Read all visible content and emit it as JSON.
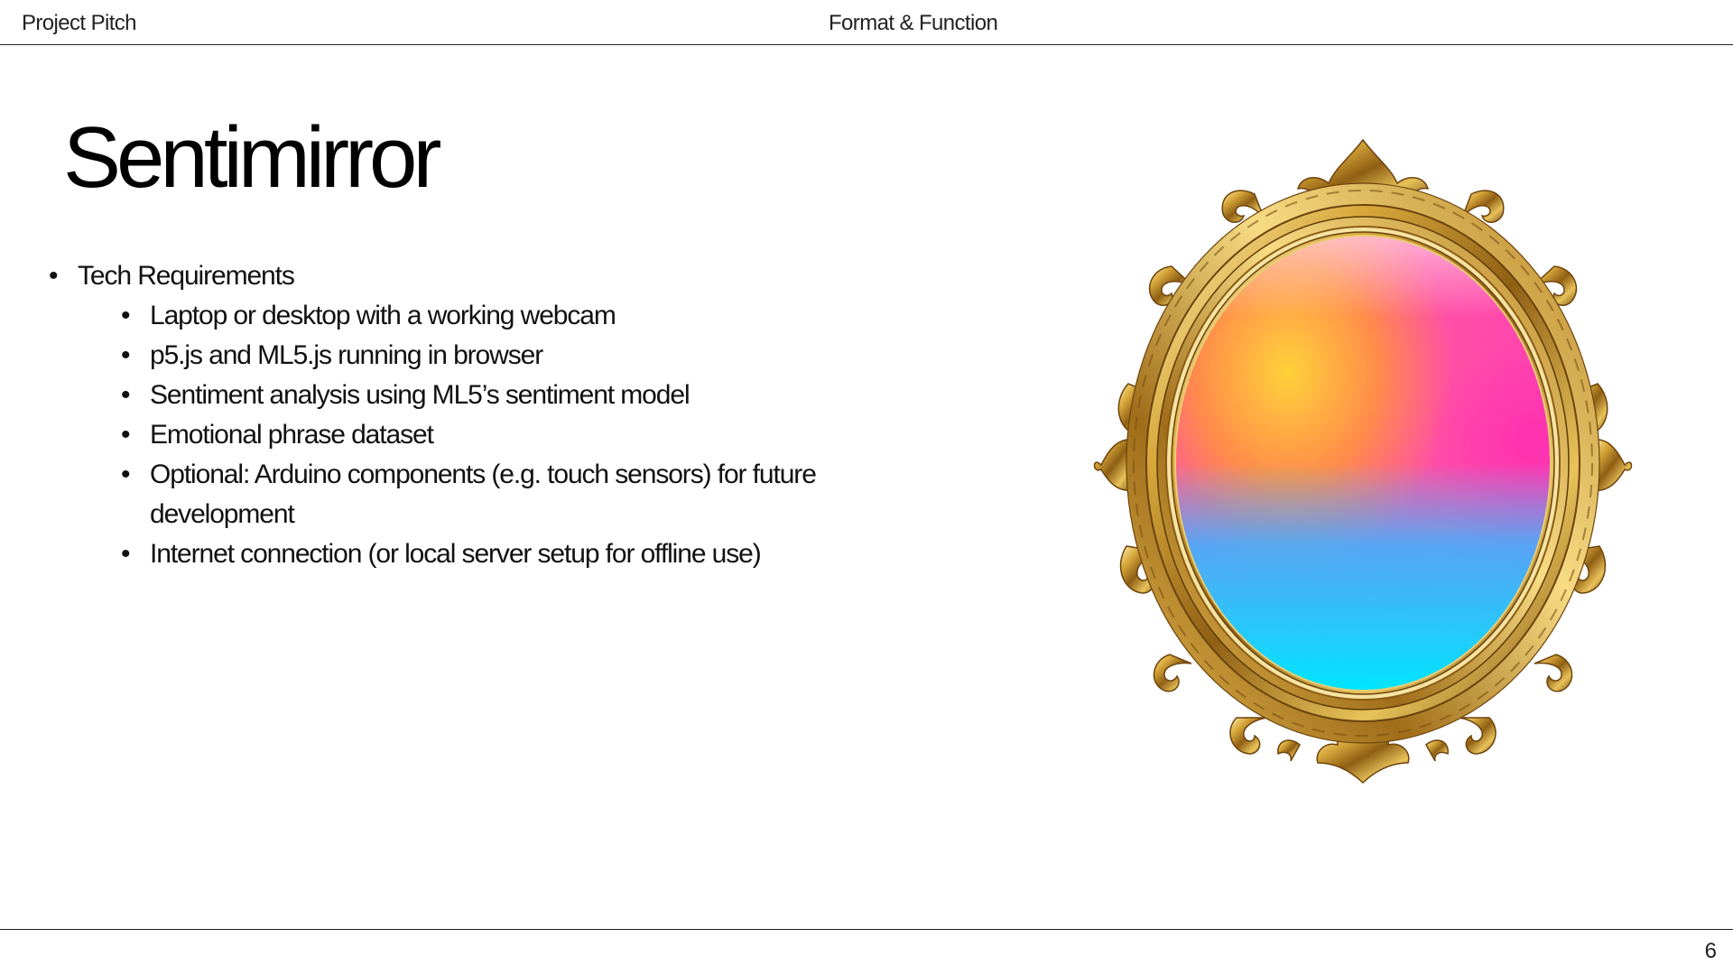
{
  "header": {
    "left": "Project Pitch",
    "center": "Format & Function"
  },
  "slide": {
    "title": "Sentimirror",
    "bullet_top": "Tech Requirements",
    "sub_bullets": [
      "Laptop or desktop with a working webcam",
      "p5.js and ML5.js running in browser",
      "Sentiment analysis using ML5’s sentiment model",
      "Emotional phrase dataset",
      "Optional: Arduino components (e.g. touch sensors) for future development",
      "Internet connection (or local server setup for offline use)"
    ],
    "image": "ornate-gold-mirror-gradient-image"
  },
  "footer": {
    "page_number": "6"
  },
  "colors": {
    "gold": "#c9962e",
    "gradient_orange": "#ffb423",
    "gradient_pink": "#ff3eb5",
    "gradient_cyan": "#00e3ff"
  }
}
